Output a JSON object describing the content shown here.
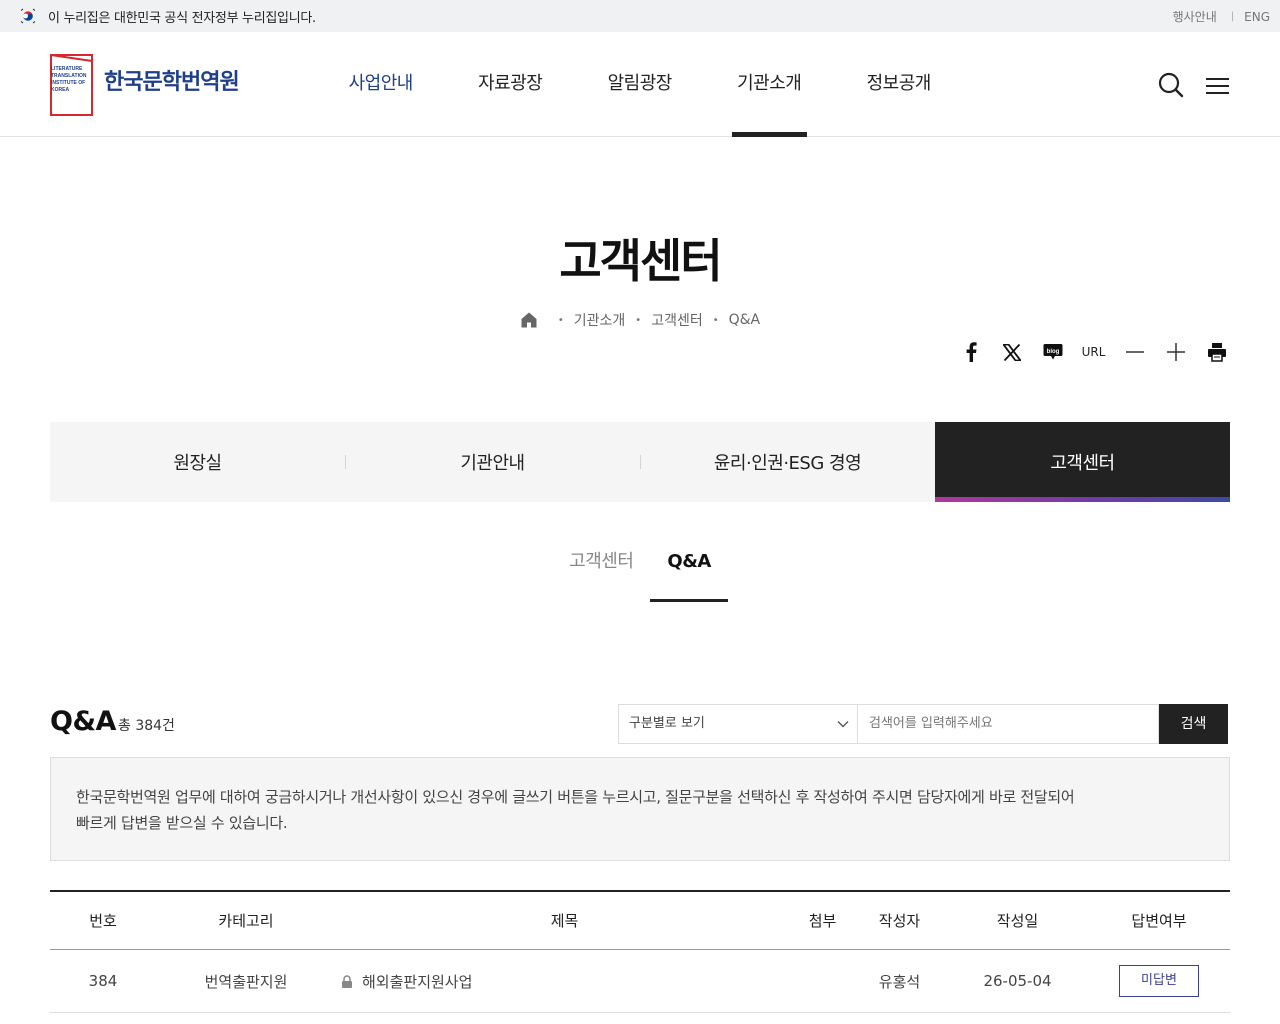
{
  "gov_banner": {
    "text": "이 누리집은 대한민국 공식 전자정부 누리집입니다.",
    "links": [
      "행사안내",
      "ENG"
    ],
    "separator": "|"
  },
  "header": {
    "logo_text_lines": [
      "LITERATURE",
      "TRANSLATION",
      "INSTITUTE OF",
      "KOREA"
    ],
    "logo_name": "한국문학번역원",
    "nav": [
      "사업안내",
      "자료광장",
      "알림광장",
      "기관소개",
      "정보공개"
    ],
    "active_nav": "기관소개"
  },
  "page": {
    "title": "고객센터",
    "breadcrumb": [
      "기관소개",
      "고객센터",
      "Q&A"
    ],
    "breadcrumb_sep": "•"
  },
  "tools": {
    "url_label": "URL",
    "items": [
      "facebook-icon",
      "x-icon",
      "blog-icon",
      "url",
      "zoom-out-icon",
      "zoom-in-icon",
      "print-icon"
    ],
    "blog_label": "blog"
  },
  "tabmenu": {
    "tabs": [
      "원장실",
      "기관안내",
      "윤리·인권·ESG 경영",
      "고객센터"
    ],
    "active": "고객센터"
  },
  "subtabs": {
    "tabs": [
      "고객센터",
      "Q&A"
    ],
    "active": "Q&A"
  },
  "board": {
    "title": "Q&A",
    "count": "총 384건",
    "select_value": "구분별로 보기",
    "search_placeholder": "검색어를 입력해주세요",
    "search_button": "검색",
    "notice_line1": "한국문학번역원 업무에 대하여 궁금하시거나 개선사항이 있으신 경우에 글쓰기 버튼을 누르시고, 질문구분을 선택하신 후 작성하여 주시면 담당자에게 바로 전달되어",
    "notice_line2": "빠르게 답변을 받으실 수 있습니다."
  },
  "table": {
    "headers": [
      "번호",
      "카테고리",
      "제목",
      "첨부",
      "작성자",
      "작성일",
      "답변여부"
    ],
    "rows": [
      {
        "no": "384",
        "category": "번역출판지원",
        "title": "해외출판지원사업",
        "attach": "",
        "writer": "유홍석",
        "date": "26-05-04",
        "answer": "미답변",
        "locked": true
      }
    ]
  },
  "colors": {
    "brand_blue": "#1e3f8a",
    "dark": "#222222",
    "answer_badge": "#3b3f9a",
    "tab_gradient": [
      "#b1379b",
      "#3d4aa6"
    ]
  }
}
